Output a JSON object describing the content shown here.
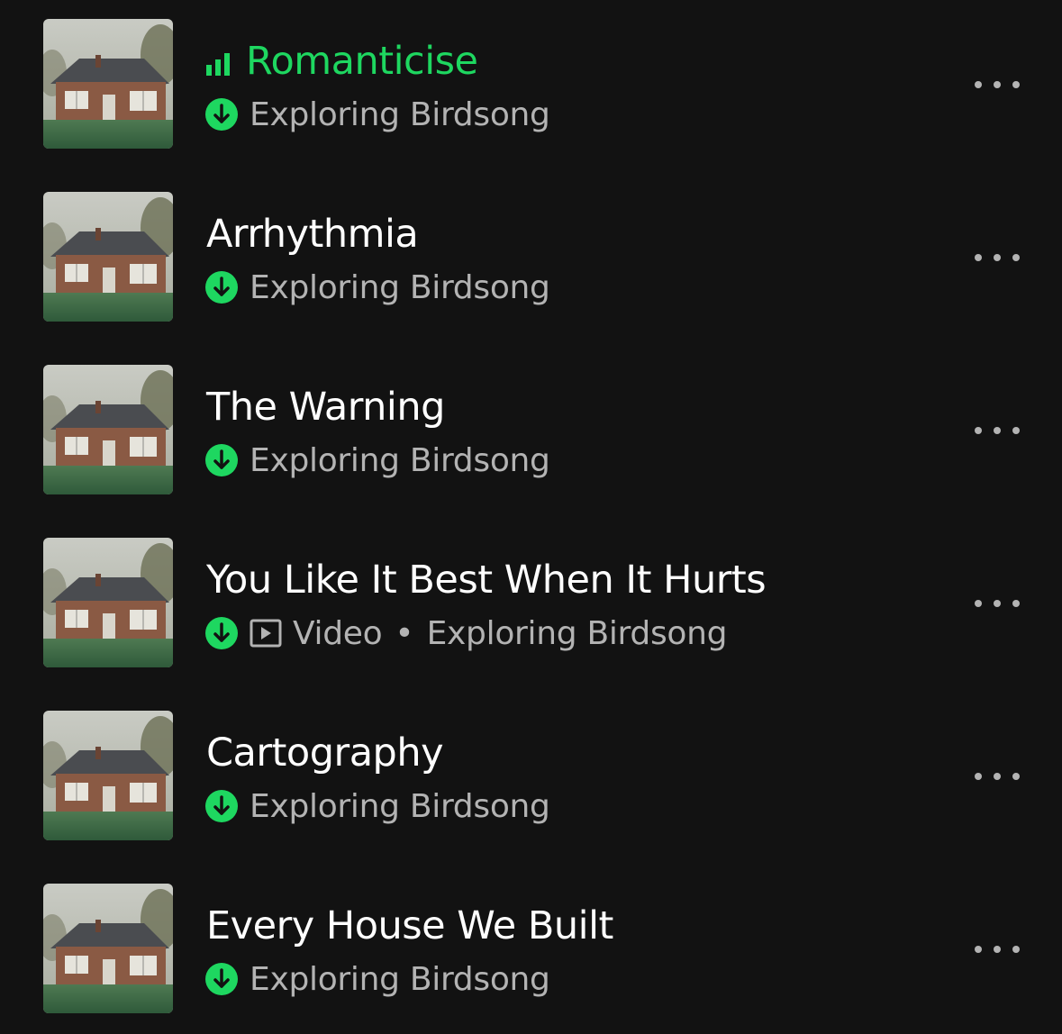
{
  "colors": {
    "background": "#121212",
    "accent": "#1ed760",
    "title": "#ffffff",
    "subtitle": "#b3b3b3"
  },
  "tracks": [
    {
      "title": "Romanticise",
      "playing": true,
      "downloaded": true,
      "video": false,
      "subtitle": "Exploring Birdsong",
      "icons": [
        "equalizer-icon",
        "download-icon",
        "more-icon"
      ]
    },
    {
      "title": "Arrhythmia",
      "playing": false,
      "downloaded": true,
      "video": false,
      "subtitle": "Exploring Birdsong",
      "icons": [
        "download-icon",
        "more-icon"
      ]
    },
    {
      "title": "The Warning",
      "playing": false,
      "downloaded": true,
      "video": false,
      "subtitle": "Exploring Birdsong",
      "icons": [
        "download-icon",
        "more-icon"
      ]
    },
    {
      "title": "You Like It Best When It Hurts",
      "playing": false,
      "downloaded": true,
      "video": true,
      "video_label": "Video",
      "separator": "•",
      "subtitle": "Exploring Birdsong",
      "icons": [
        "download-icon",
        "video-icon",
        "more-icon"
      ]
    },
    {
      "title": "Cartography",
      "playing": false,
      "downloaded": true,
      "video": false,
      "subtitle": "Exploring Birdsong",
      "icons": [
        "download-icon",
        "more-icon"
      ]
    },
    {
      "title": "Every House We Built",
      "playing": false,
      "downloaded": true,
      "video": false,
      "subtitle": "Exploring Birdsong",
      "icons": [
        "download-icon",
        "more-icon"
      ]
    }
  ]
}
